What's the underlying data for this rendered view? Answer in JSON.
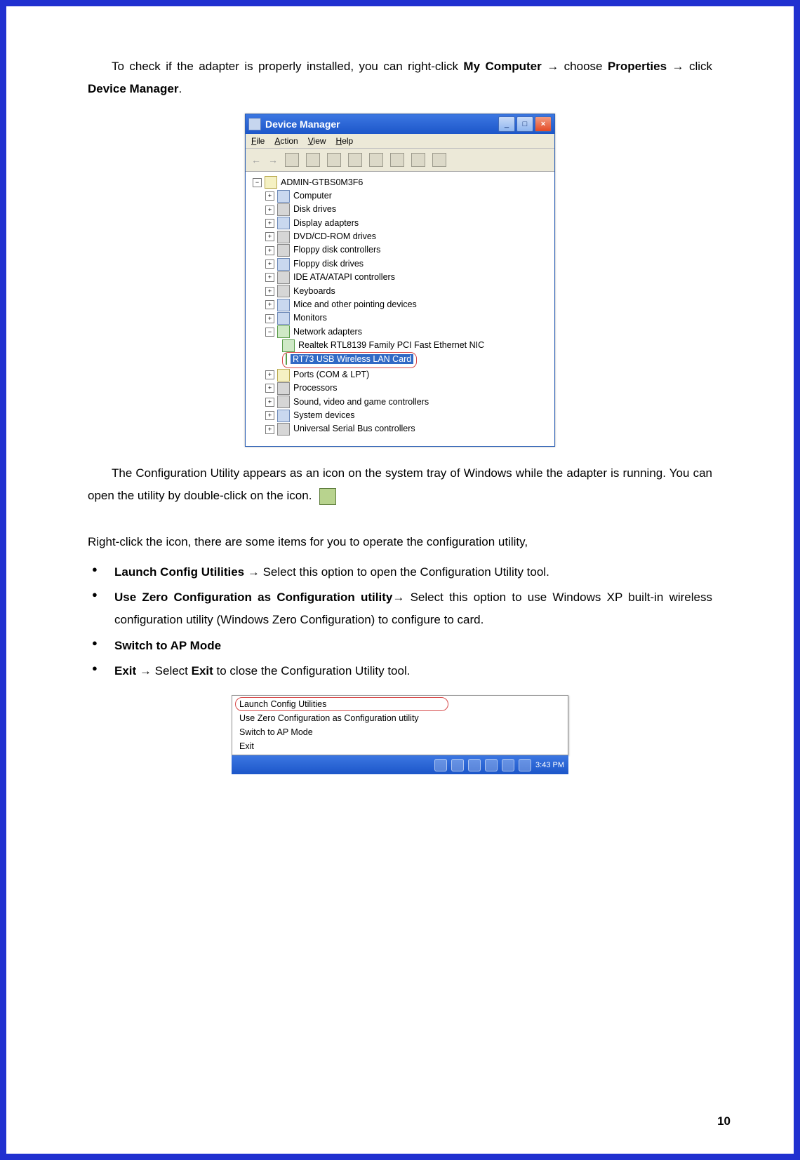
{
  "intro": {
    "pre": "To check if the adapter is properly installed, you can right-click ",
    "b1": "My Computer",
    "mid1": " choose ",
    "b2": "Properties",
    "mid2": " click ",
    "b3": "Device Manager",
    "post": "."
  },
  "arrow": "→",
  "dm": {
    "title": "Device Manager",
    "menu": {
      "file": "File",
      "action": "Action",
      "view": "View",
      "help": "Help"
    },
    "root": "ADMIN-GTBS0M3F6",
    "nodes": [
      "Computer",
      "Disk drives",
      "Display adapters",
      "DVD/CD-ROM drives",
      "Floppy disk controllers",
      "Floppy disk drives",
      "IDE ATA/ATAPI controllers",
      "Keyboards",
      "Mice and other pointing devices",
      "Monitors",
      "Network adapters",
      "Ports (COM & LPT)",
      "Processors",
      "Sound, video and game controllers",
      "System devices",
      "Universal Serial Bus controllers"
    ],
    "net": {
      "a": "Realtek RTL8139 Family PCI Fast Ethernet NIC",
      "b": "RT73 USB Wireless LAN Card"
    }
  },
  "para2": "The Configuration Utility appears as an icon on the system tray of Windows while the adapter is running. You can open the utility by double-click on the icon.",
  "rc_intro": "Right-click the icon, there are some items for you to operate the configuration utility,",
  "opts": {
    "o1b": "Launch Config Utilities",
    "o1": " Select this option to open the Configuration Utility tool.",
    "o2b": "Use Zero Configuration as Configuration utility",
    "o2": " Select this option to use Windows XP built-in wireless configuration utility (Windows Zero Configuration) to configure to card.",
    "o3b": "Switch to AP Mode",
    "o4b": "Exit",
    "o4mid": " Select ",
    "o4b2": "Exit",
    "o4": " to close the Configuration Utility tool."
  },
  "ctx": {
    "items": [
      "Launch Config Utilities",
      "Use Zero Configuration as Configuration utility",
      "Switch to AP Mode",
      "Exit"
    ],
    "time": "3:43 PM"
  },
  "page_number": "10"
}
